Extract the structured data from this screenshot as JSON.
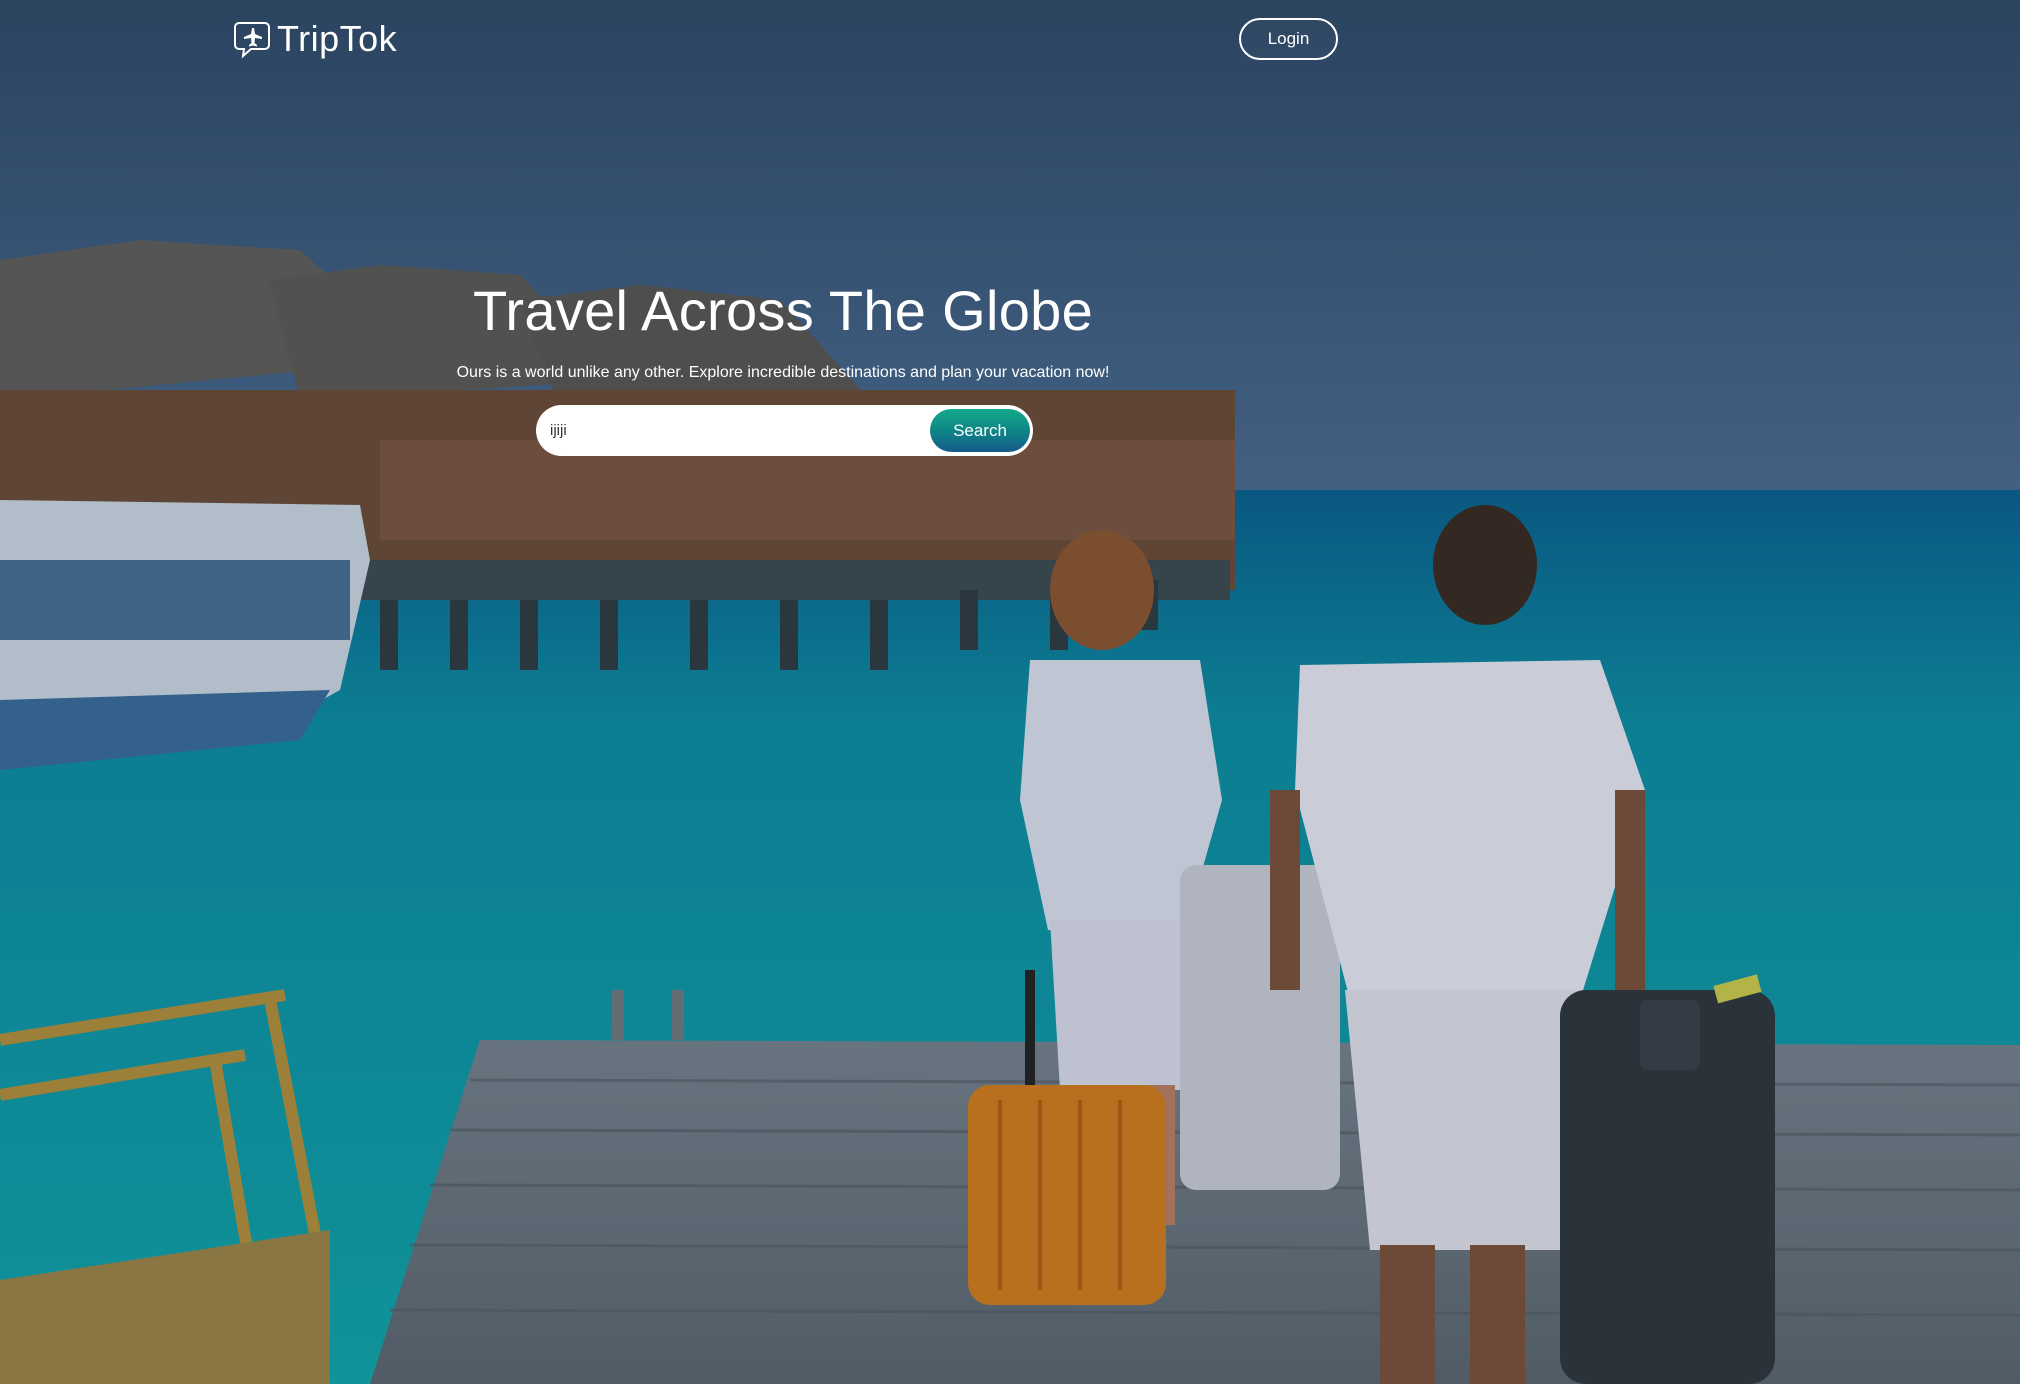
{
  "header": {
    "logo_text": "TripTok",
    "logo_icon": "airplane-chat-bubble-icon",
    "login_label": "Login"
  },
  "hero": {
    "title": "Travel Across The Globe",
    "subtitle": "Ours is a world unlike any other. Explore incredible destinations and plan your vacation now!",
    "background": "dock-by-turquoise-sea-with-travelers-image"
  },
  "search": {
    "value": "ijiji",
    "placeholder": "",
    "button_label": "Search"
  },
  "colors": {
    "search_button_top": "#13a98b",
    "search_button_bottom": "#155a8a",
    "sky": "#3a5878",
    "sea": "#0f8f9a"
  }
}
